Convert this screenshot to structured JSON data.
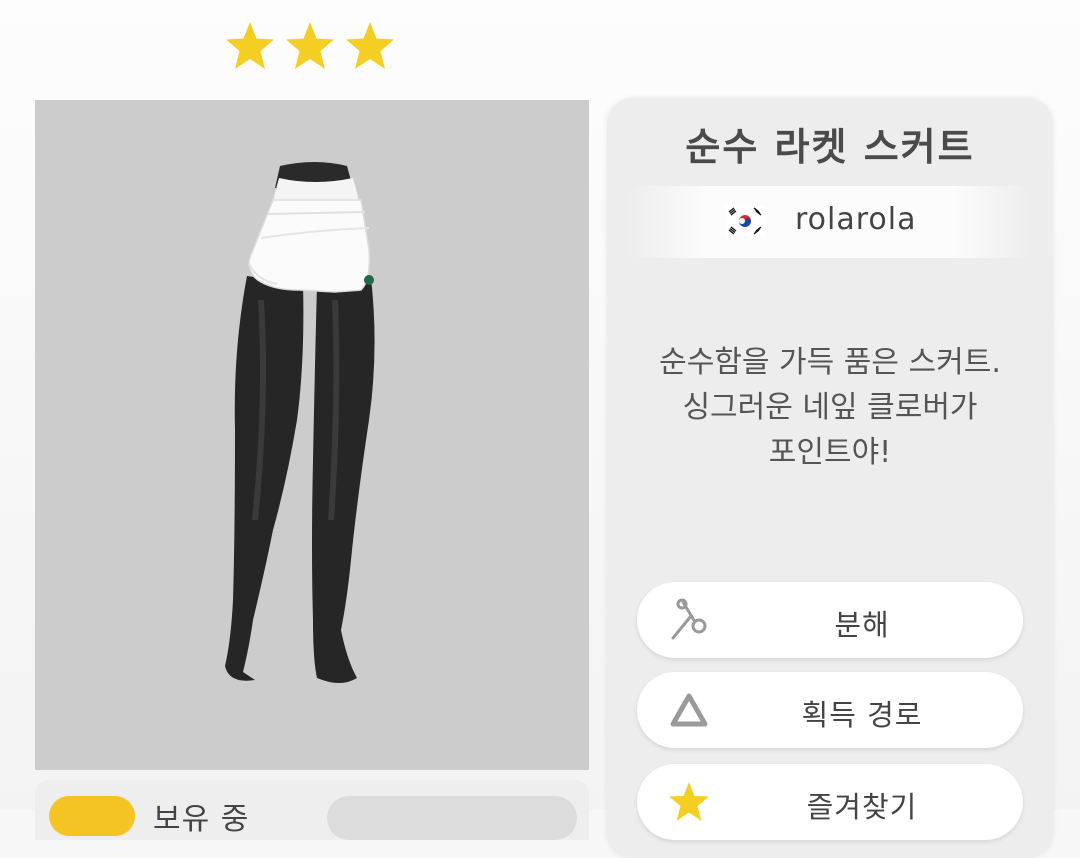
{
  "rating": {
    "stars": 3,
    "star_color": "#F5CE24"
  },
  "item": {
    "title": "순수 라켓 스커트",
    "creator": "rolarola",
    "creator_flag": "korea-flag-icon",
    "description": "순수함을 가득 품은 스커트.\n싱그러운 네잎 클로버가\n포인트야!"
  },
  "actions": {
    "disassemble_label": "분해",
    "acquire_route_label": "획득 경로",
    "favorite_label": "즐겨찾기"
  },
  "owned": {
    "label": "보유 중"
  },
  "colors": {
    "preview_bg": "#CCCCCC",
    "panel_bg": "#EDEDED",
    "accent_yellow": "#F5CE24"
  }
}
